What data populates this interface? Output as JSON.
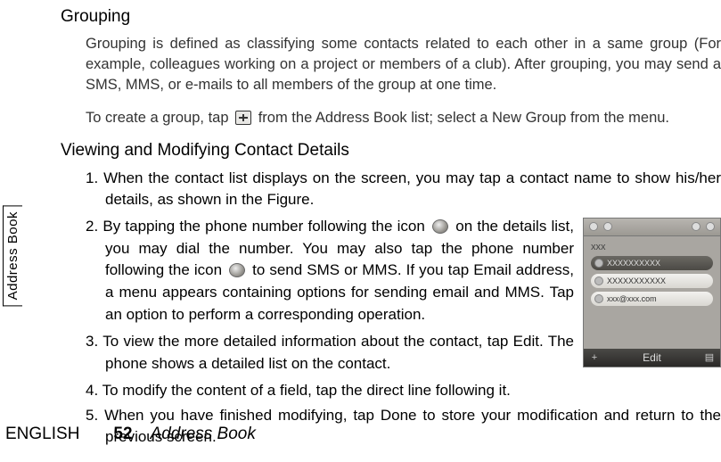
{
  "sections": {
    "grouping": {
      "heading": "Grouping",
      "para1": "Grouping is defined as classifying some contacts related to each other in a same group (For example, colleagues working on a project or members of a club). After grouping, you may send a SMS, MMS, or e-mails to all members of the group at one time.",
      "para2_pre": "To create a group, tap",
      "para2_post": "from the Address Book list; select a New Group from the menu."
    },
    "viewing": {
      "heading": "Viewing and Modifying Contact Details",
      "item1": "1. When the contact list displays on the screen, you may tap a contact name to show his/her details, as shown in the Figure.",
      "item2_pre": "2. By tapping the phone number following the icon",
      "item2_mid1": "on the details list, you may dial the number. You may also tap the phone number following the icon",
      "item2_mid2": "to send SMS or MMS. If you tap Email address, a menu appears containing options for sending email and MMS. Tap an option to perform a corresponding operation.",
      "item3": "3. To view the more detailed information about the contact, tap Edit. The phone shows a detailed list on the contact.",
      "item4": "4. To modify the content of a field, tap the direct line following it.",
      "item5": "5. When you have finished modifying, tap Done to store your modification and return to the previous screen."
    }
  },
  "phone": {
    "name": "xxx",
    "row1": "XXXXXXXXXX",
    "row2": "XXXXXXXXXXX",
    "row3": "xxx@xxx.com",
    "edit": "Edit"
  },
  "side_tab": "Address Book",
  "footer": {
    "language": "ENGLISH",
    "page": "52",
    "title": "Address Book"
  }
}
